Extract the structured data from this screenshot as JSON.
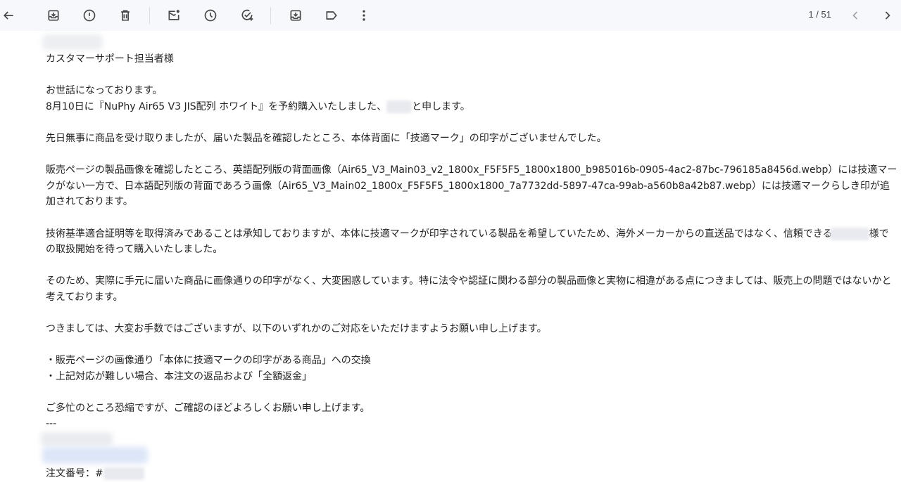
{
  "toolbar": {
    "back_icon": "arrow-left-icon",
    "archive_icon": "archive-icon",
    "report_spam_icon": "report-spam-icon",
    "delete_icon": "trash-icon",
    "mark_unread_icon": "mark-unread-icon",
    "snooze_icon": "clock-icon",
    "add_task_icon": "add-task-icon",
    "move_to_icon": "move-to-icon",
    "label_icon": "label-icon",
    "more_icon": "more-vert-icon",
    "pager_text": "1 / 51",
    "prev_icon": "chevron-left-icon",
    "next_icon": "chevron-right-icon"
  },
  "email": {
    "greeting": "カスタマーサポート担当者様",
    "p1_line1": "お世話になっております。",
    "p1_line2_a": "8月10日に『NuPhy Air65 V3 JIS配列 ホワイト』を予約購入いたしました、",
    "p1_line2_b": "と申します。",
    "p2": "先日無事に商品を受け取りましたが、届いた製品を確認したところ、本体背面に「技適マーク」の印字がございませんでした。",
    "p3": "販売ページの製品画像を確認したところ、英語配列版の背面画像（Air65_V3_Main03_v2_1800x_F5F5F5_1800x1800_b985016b-0905-4ac2-87bc-796185a8456d.webp）には技適マークがない一方で、日本語配列版の背面であろう画像（Air65_V3_Main02_1800x_F5F5F5_1800x1800_7a7732dd-5897-47ca-99ab-a560b8a42b87.webp）には技適マークらしき印が追加されております。",
    "p4_a": "技術基準適合証明等を取得済みであることは承知しておりますが、本体に技適マークが印字されている製品を希望していたため、海外メーカーからの直送品ではなく、信頼できる",
    "p4_b": "様での取扱開始を待って購入いたしました。",
    "p5": "そのため、実際に手元に届いた商品に画像通りの印字がなく、大変困惑しています。特に法令や認証に関わる部分の製品画像と実物に相違がある点につきましては、販売上の問題ではないかと考えております。",
    "p6": "つきましては、大変お手数ではございますが、以下のいずれかのご対応をいただけますようお願い申し上げます。",
    "bullet1": "・販売ページの画像通り「本体に技適マークの印字がある商品」への交換",
    "bullet2": "・上記対応が難しい場合、本注文の返品および「全額返金」",
    "closing": "ご多忙のところ恐縮ですが、ご確認のほどよろしくお願い申し上げます。",
    "separator": "---",
    "order_label": "注文番号：#"
  },
  "colors": {
    "toolbar_bg": "#f6f8fc",
    "icon": "#444746",
    "text": "#222222"
  }
}
